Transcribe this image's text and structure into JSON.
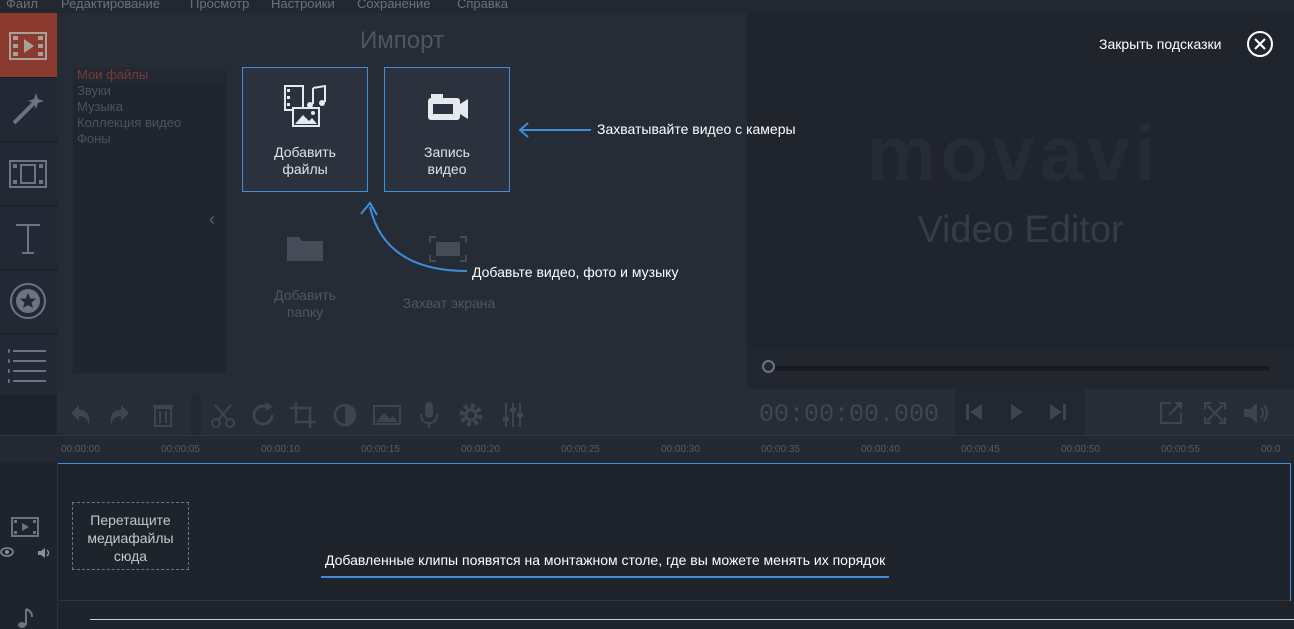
{
  "menu": [
    "Файл",
    "Редактирование",
    "Просмотр",
    "Настройки",
    "Сохранение",
    "Справка"
  ],
  "sidebar": {
    "tabs": [
      "import-tab",
      "effects-tab",
      "transitions-tab",
      "titles-tab",
      "stickers-tab",
      "list-tab"
    ],
    "active": "import-tab"
  },
  "import": {
    "title": "Импорт",
    "categories": [
      "Мои файлы",
      "Звуки",
      "Музыка",
      "Коллекция видео",
      "Фоны"
    ],
    "active_category": "Мои файлы",
    "add_files_l1": "Добавить",
    "add_files_l2": "файлы",
    "record_video_l1": "Запись",
    "record_video_l2": "видео",
    "add_folder_l1": "Добавить",
    "add_folder_l2": "папку",
    "screen_capture": "Захват экрана"
  },
  "preview": {
    "logo": "movavi",
    "brand": "Video Editor"
  },
  "player": {
    "timecode": "00:00:00.000"
  },
  "timeline": {
    "ticks": [
      "00:00:00",
      "00:00:05",
      "00:00:10",
      "00:00:15",
      "00:00:20",
      "00:00:25",
      "00:00:30",
      "00:00:35",
      "00:00:40",
      "00:00:45",
      "00:00:50",
      "00:00:55",
      "00:0"
    ],
    "drop_l1": "Перетащите",
    "drop_l2": "медиафайлы",
    "drop_l3": "сюда"
  },
  "hints": {
    "close": "Закрыть подсказки",
    "camera": "Захватывайте видео с камеры",
    "add_media": "Добавьте видео, фото и музыку",
    "timeline": "Добавленные клипы появятся на монтажном столе, где вы можете менять их порядок"
  },
  "colors": {
    "accent": "#3f8edb",
    "active_tab": "#8a3a2e",
    "background": "#1d222b"
  }
}
